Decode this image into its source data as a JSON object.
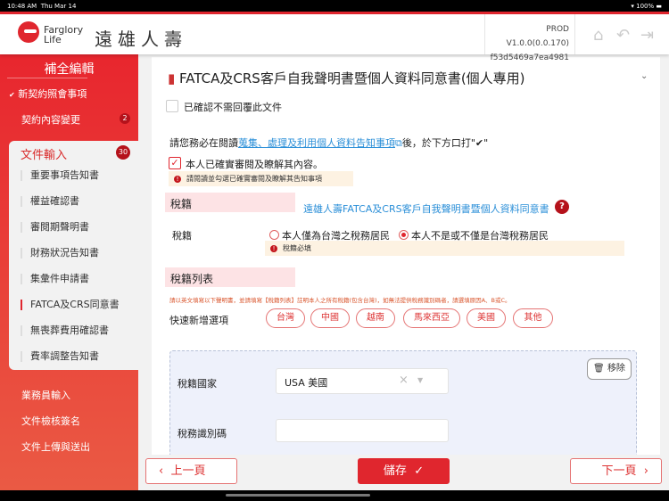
{
  "status": {
    "time": "10:48 AM",
    "date": "Thu Mar 14",
    "battery": "100%"
  },
  "header": {
    "logo_en_1": "Farglory",
    "logo_en_2": "Life",
    "logo_zh": "遠雄人壽",
    "version": "PROD V1.0.0(0.0.170)",
    "hash": "f53d5469a7ea4981"
  },
  "sidebar": {
    "title": "補全編輯",
    "items": [
      {
        "label": "新契約照會事項",
        "check": "✔"
      },
      {
        "label": "契約內容變更",
        "badge": "2"
      }
    ],
    "sub": {
      "label": "文件輸入",
      "badge": "30",
      "items": [
        "重要事項告知書",
        "權益確認書",
        "審閱期聲明書",
        "財務狀況告知書",
        "集彙件申請書",
        "FATCA及CRS同意書",
        "無喪葬費用確認書",
        "費率調整告知書"
      ]
    },
    "bottom": [
      "業務員輸入",
      "文件檢核簽名",
      "文件上傳與送出"
    ]
  },
  "form": {
    "title": "FATCA及CRS客戶自我聲明書暨個人資料同意書(個人專用)",
    "no_reply": "已確認不需回覆此文件",
    "notice_pre": "請您務必在閱讀",
    "notice_link": "蒐集、處理及利用個人資料告知事項",
    "notice_post": "後，於下方口打\"✔\"",
    "agree": "本人已確實審閱及瞭解其內容。",
    "agree_warn": "請閱讀並勾選已確實審閱及瞭解其告知事項",
    "sec_tax": "稅籍",
    "doc_link": "遠雄人壽FATCA及CRS客戶自我聲明書暨個人資料同意書",
    "tax_label": "稅籍",
    "radio1": "本人僅為台灣之稅務居民",
    "radio2": "本人不是或不僅是台灣稅務居民",
    "tax_warn": "稅籍必填",
    "sec_list": "稅籍列表",
    "list_note": "請以英文填寫以下聲明書，並請填寫【稅籍列表】註明本人之所有稅籍(包含台灣)，如無法提供稅務識別碼者，請選填原因A、B或C。",
    "quick_label": "快速新增選項",
    "quick": [
      "台灣",
      "中國",
      "越南",
      "馬來西亞",
      "美國",
      "其他"
    ],
    "country_label": "稅籍國家",
    "country_value": "USA 美國",
    "tin_label": "稅務識別碼",
    "tin_value": "",
    "remove": "移除"
  },
  "footer": {
    "prev": "上一頁",
    "save": "儲存",
    "next": "下一頁"
  }
}
